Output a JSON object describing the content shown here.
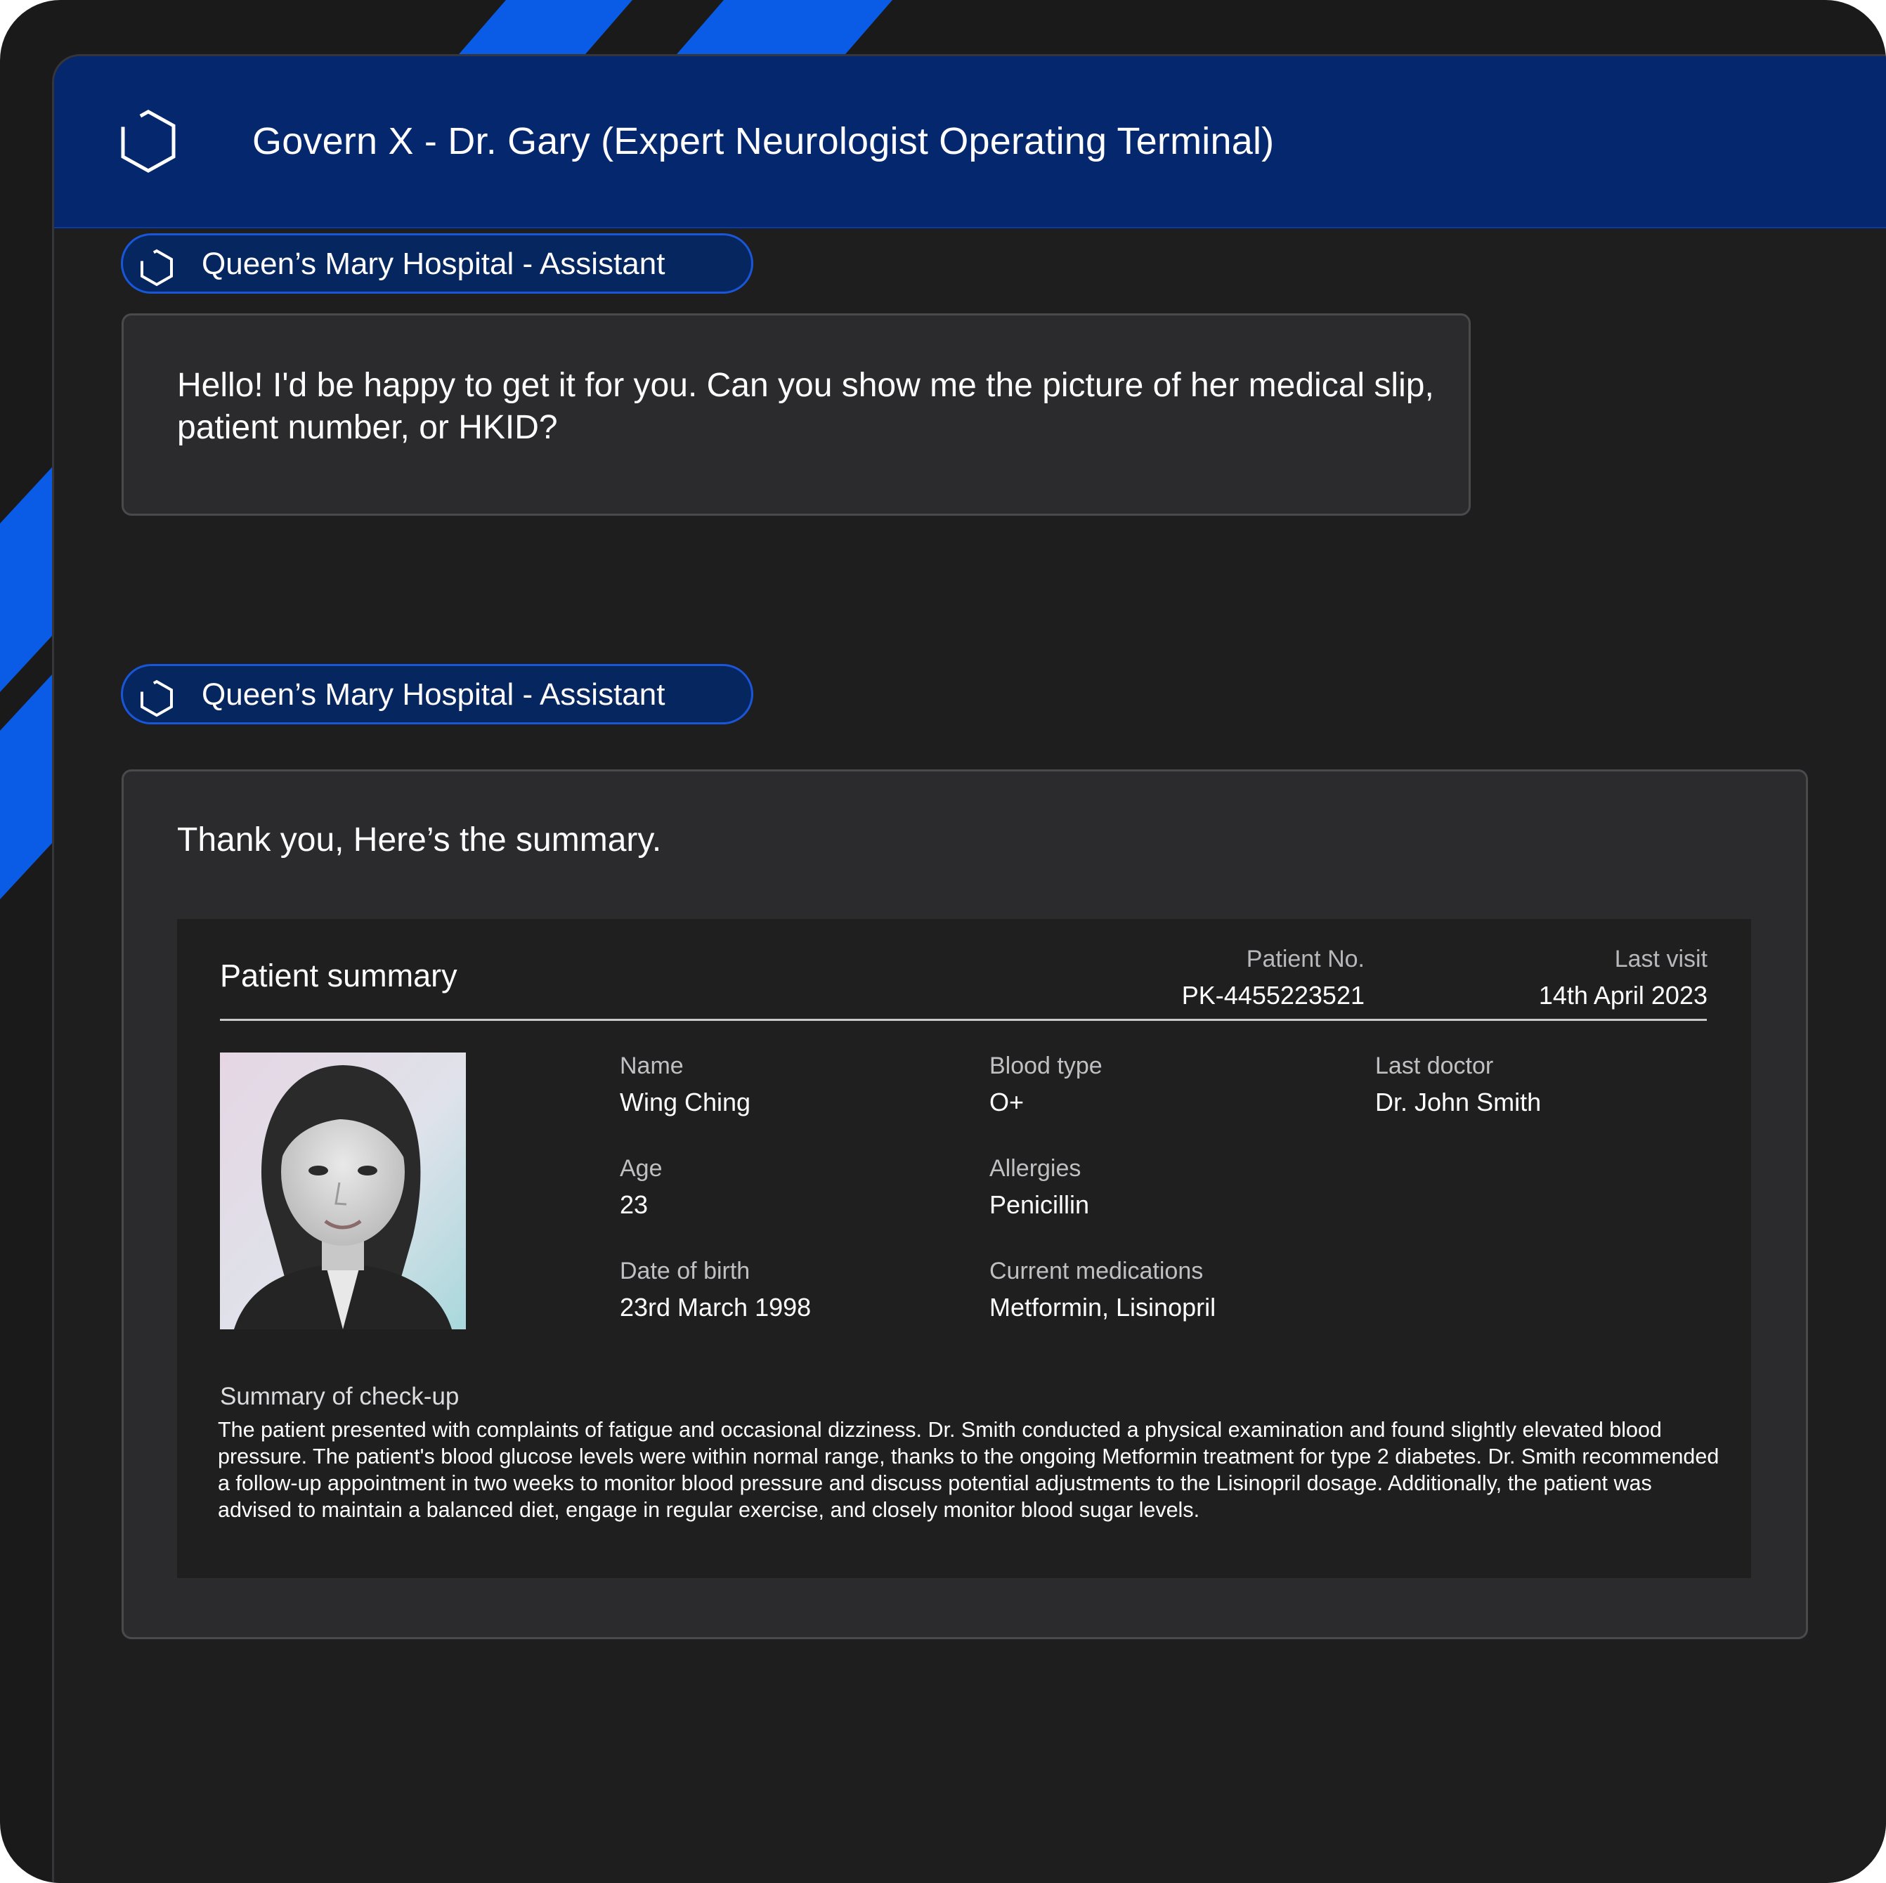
{
  "window": {
    "title": "Govern X - Dr. Gary (Expert Neurologist Operating Terminal)",
    "logo_icon": "hexagon-logo-icon"
  },
  "messages": [
    {
      "sender": "Queen’s Mary Hospital - Assistant",
      "text": "Hello! I'd be happy to get it for you. Can you show me the picture of her medical slip, patient number, or HKID?"
    },
    {
      "sender": "Queen’s Mary Hospital - Assistant",
      "text": "Thank you, Here’s the summary."
    }
  ],
  "patient_card": {
    "title": "Patient summary",
    "patient_no_label": "Patient No.",
    "patient_no": "PK-4455223521",
    "last_visit_label": "Last visit",
    "last_visit": "14th April 2023",
    "fields": {
      "name_label": "Name",
      "name": "Wing Ching",
      "age_label": "Age",
      "age": "23",
      "dob_label": "Date of birth",
      "dob": "23rd March 1998",
      "blood_type_label": "Blood type",
      "blood_type": "O+",
      "allergies_label": "Allergies",
      "allergies": "Penicillin",
      "medications_label": "Current medications",
      "medications": "Metformin, Lisinopril",
      "last_doctor_label": "Last doctor",
      "last_doctor": "Dr. John Smith"
    },
    "summary_label": "Summary of check-up",
    "summary_text": "The patient presented with complaints of fatigue and occasional dizziness. Dr. Smith conducted a physical examination and found slightly elevated blood pressure. The patient's blood glucose levels were within normal range, thanks to the ongoing Metformin treatment for type 2 diabetes. Dr. Smith recommended a follow-up appointment in two weeks to monitor blood pressure and discuss potential adjustments to the Lisinopril dosage. Additionally, the patient was advised to maintain a balanced diet, engage in regular exercise, and closely monitor blood sugar levels."
  },
  "colors": {
    "background": "#1a1a1b",
    "accent_blue": "#0a5ce6",
    "titlebar": "#04276e",
    "bubble": "#2b2b2d",
    "card": "#1f1f20"
  }
}
